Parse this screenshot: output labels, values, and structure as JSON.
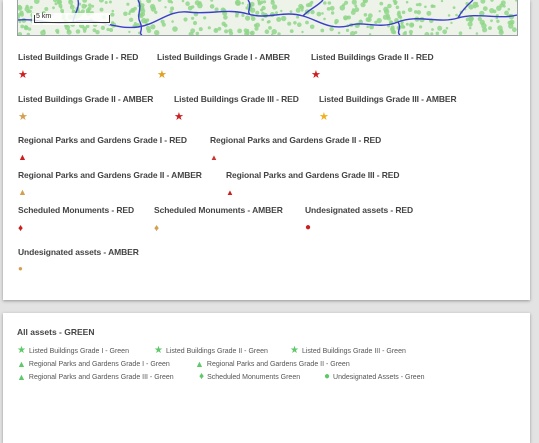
{
  "map": {
    "scale_label": "5 km",
    "colors": {
      "background": "#eef3ea",
      "dots": "#8fd68a",
      "boundaries": "#3a3fc9"
    }
  },
  "legend": [
    {
      "label": "Listed Buildings Grade I - RED",
      "icon": "star-icon",
      "color": "#cc1f1f"
    },
    {
      "label": "Listed Buildings Grade I - AMBER",
      "icon": "star-icon",
      "color": "#e0a020"
    },
    {
      "label": "Listed Buildings Grade II - RED",
      "icon": "star-icon",
      "color": "#cc1f1f"
    },
    {
      "label": "Listed Buildings Grade II - AMBER",
      "icon": "star-icon",
      "color": "#d4a050"
    },
    {
      "label": "Listed Buildings Grade III - RED",
      "icon": "star-icon",
      "color": "#cc1f1f"
    },
    {
      "label": "Listed Buildings Grade III - AMBER",
      "icon": "star-icon",
      "color": "#f0b020"
    },
    {
      "label": "Regional Parks and Gardens Grade I - RED",
      "icon": "triangle-icon",
      "color": "#cc1f1f"
    },
    {
      "label": "Regional Parks and Gardens Grade II - RED",
      "icon": "triangle-icon",
      "color": "#cc3333"
    },
    {
      "label": "Regional Parks and Gardens Grade II - AMBER",
      "icon": "triangle-icon",
      "color": "#d4a050"
    },
    {
      "label": "Regional Parks and Gardens Grade III - RED",
      "icon": "triangle-icon",
      "color": "#cc1f1f"
    },
    {
      "label": "Scheduled Monuments - RED",
      "icon": "diamond-icon",
      "color": "#cc1f1f"
    },
    {
      "label": "Scheduled Monuments - AMBER",
      "icon": "diamond-icon",
      "color": "#d4a050"
    },
    {
      "label": "Undesignated assets - RED",
      "icon": "circle-icon",
      "color": "#cc1f1f"
    },
    {
      "label": "Undesignated assets - AMBER",
      "icon": "circle-icon",
      "color": "#d4a050"
    }
  ],
  "green": {
    "title": "All assets - GREEN",
    "color": "#5fc96a",
    "items": [
      {
        "label": "Listed Buildings Grade I - Green",
        "icon": "star-icon"
      },
      {
        "label": "Listed Buildings Grade II - Green",
        "icon": "star-icon"
      },
      {
        "label": "Listed Buildings Grade III - Green",
        "icon": "star-icon"
      },
      {
        "label": "Regional Parks and Gardens Grade I - Green",
        "icon": "triangle-icon"
      },
      {
        "label": "Regional Parks and Gardens Grade II - Green",
        "icon": "triangle-icon"
      },
      {
        "label": "Regional Parks and Gardens Grade III - Green",
        "icon": "triangle-icon"
      },
      {
        "label": "Scheduled Monuments Green",
        "icon": "diamond-icon"
      },
      {
        "label": "Undesignated Assets - Green",
        "icon": "circle-icon"
      }
    ]
  }
}
